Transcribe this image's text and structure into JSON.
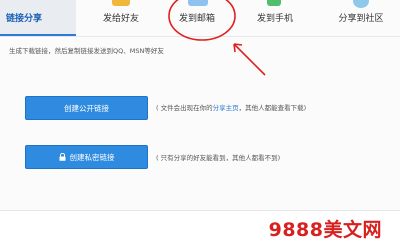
{
  "tabs": [
    {
      "label": "链接分享",
      "active": true
    },
    {
      "label": "发给好友",
      "active": false,
      "icon": "friend-icon",
      "color": "#f1b73b"
    },
    {
      "label": "发到邮箱",
      "active": false,
      "icon": "mail-icon",
      "color": "#8fc2ee"
    },
    {
      "label": "发到手机",
      "active": false,
      "icon": "phone-icon",
      "color": "#4fbf6b"
    },
    {
      "label": "分享到社区",
      "active": false,
      "icon": "community-icon",
      "color": "#8ec9ec"
    }
  ],
  "description": "生成下载链接，然后复制链接发送到QQ、MSN等好友",
  "public_link": {
    "button_label": "创建公开链接",
    "note_prefix": "( 文件会出现在你的",
    "note_highlight": "分享主页",
    "note_suffix": "，其他人都能查看下载)"
  },
  "private_link": {
    "button_label": "创建私密链接",
    "note": "( 只有分享的好友能看到，其他人都看不到)"
  },
  "watermark": "9888美文网",
  "colors": {
    "accent": "#2e8be0",
    "annotation": "#e02020",
    "watermark": "#d8201e"
  }
}
